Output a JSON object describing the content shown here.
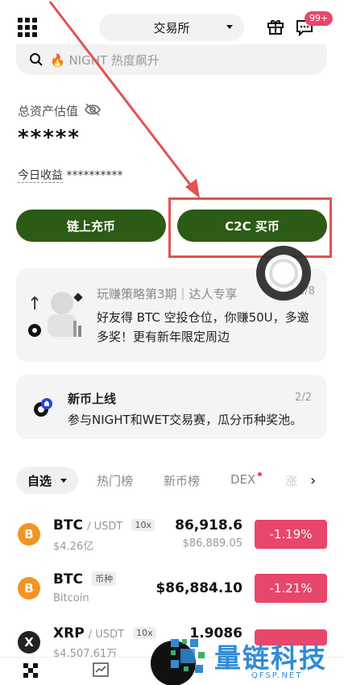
{
  "header": {
    "exchange_label": "交易所",
    "badge": "99+"
  },
  "search": {
    "placeholder": "🔥 NIGHT 热度飙升"
  },
  "assets": {
    "label": "总资产估值",
    "value": "*****",
    "pnl_label": "今日收益",
    "pnl_value": "**********"
  },
  "actions": {
    "deposit": "链上充币",
    "c2c": "C2C 买币"
  },
  "banner1": {
    "title": "玩赚策略第3期｜达人专享",
    "page": "2/8",
    "body": "好友得 BTC 空投仓位，你赚50U，多邀多奖！更有新年限定周边"
  },
  "banner2": {
    "title": "新币上线",
    "page": "2/2",
    "body": "参与NIGHT和WET交易赛，瓜分币种奖池。"
  },
  "tabs": {
    "active": "自选",
    "items": [
      "热门榜",
      "新币榜",
      "DEX"
    ],
    "more": "涨"
  },
  "market": [
    {
      "symbol": "BTC",
      "pair": "/ USDT",
      "tag": "10x",
      "sub": "$4.26亿",
      "price": "86,918.6",
      "price_sub": "$86,889.05",
      "change": "-1.19%",
      "icon": "B"
    },
    {
      "symbol": "BTC",
      "pair": "",
      "tag": "币种",
      "sub": "Bitcoin",
      "price": "$86,884.10",
      "price_sub": "",
      "change": "-1.21%",
      "icon": "B"
    },
    {
      "symbol": "XRP",
      "pair": "/ USDT",
      "tag": "10x",
      "sub": "$4,507.61万",
      "price": "1.9086",
      "price_sub": "",
      "change": "",
      "icon": "X"
    }
  ],
  "watermark": {
    "text": "量链科技",
    "url": "QFSP.NET"
  },
  "colors": {
    "primary_green": "#2b5b14",
    "negative_red": "#e8466a",
    "annotation_red": "#e2524f"
  }
}
